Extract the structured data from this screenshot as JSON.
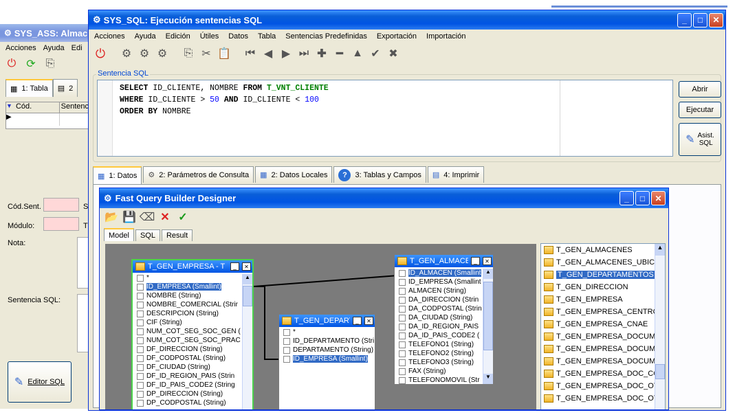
{
  "bg_window": {
    "title": "SYS_ASS: Almac",
    "menus": [
      "Acciones",
      "Ayuda",
      "Edi"
    ],
    "tab_label": "1: Tabla",
    "tab2_label": "2",
    "col_cod": "Cód.",
    "col_sent": "Sentenc",
    "cod_sent_label": "Cód.Sent.",
    "modulo_label": "Módulo:",
    "nota_label": "Nota:",
    "sentencia_label": "Sentencia SQL:",
    "editor_button": "Editor SQL",
    "s_label": "S",
    "t_label": "T"
  },
  "main_window": {
    "title": "SYS_SQL: Ejecución sentencias SQL",
    "menus": [
      "Acciones",
      "Ayuda",
      "Edición",
      "Útiles",
      "Datos",
      "Tabla",
      "Sentencias Predefinidas",
      "Exportación",
      "Importación"
    ],
    "group_label": "Sentencia SQL",
    "sql_lines": [
      [
        "SELECT",
        " ID_CLIENTE, NOMBRE ",
        "FROM",
        " ",
        "T_VNT_CLIENTE"
      ],
      [
        "WHERE",
        " ID_CLIENTE > ",
        "50",
        " ",
        "AND",
        " ID_CLIENTE < ",
        "100"
      ],
      [
        "ORDER BY",
        " NOMBRE"
      ]
    ],
    "btn_abrir": "Abrir",
    "btn_ejecutar": "Ejecutar",
    "btn_asist": "Asist.",
    "btn_asist2": "SQL",
    "tabs": [
      "1: Datos",
      "2: Parámetros de Consulta",
      "2: Datos Locales",
      "3: Tablas y Campos",
      "4: Imprimir"
    ]
  },
  "qb_window": {
    "title": "Fast Query Builder  Designer",
    "tabs": [
      "Model",
      "SQL",
      "Result"
    ],
    "tables": [
      {
        "title": "T_GEN_EMPRESA - T",
        "fields": [
          "*",
          "ID_EMPRESA (Smallint)",
          "NOMBRE (String)",
          "NOMBRE_COMERCIAL (Strir",
          "DESCRIPCION (String)",
          "CIF (String)",
          "NUM_COT_SEG_SOC_GEN (",
          "NUM_COT_SEG_SOC_PRAC",
          "DF_DIRECCION (String)",
          "DF_CODPOSTAL (String)",
          "DF_CIUDAD (String)",
          "DF_ID_REGION_PAIS (Strin",
          "DF_ID_PAIS_CODE2 (String",
          "DP_DIRECCION (String)",
          "DP_CODPOSTAL (String)"
        ],
        "selected": 1
      },
      {
        "title": "T_GEN_DEPART",
        "fields": [
          "*",
          "ID_DEPARTAMENTO (Stri",
          "DEPARTAMENTO (String)",
          "ID_EMPRESA (Smallint)"
        ],
        "selected": 3
      },
      {
        "title": "T_GEN_ALMACE",
        "fields": [
          "ID_ALMACEN (Smallint",
          "ID_EMPRESA (Smallint",
          "ALMACEN (String)",
          "DA_DIRECCION (Strin",
          "DA_CODPOSTAL (Strin",
          "DA_CIUDAD (String)",
          "DA_ID_REGION_PAIS",
          "DA_ID_PAIS_CODE2 (",
          "TELEFONO1 (String)",
          "TELEFONO2 (String)",
          "TELEFONO3 (String)",
          "FAX (String)",
          "TELEFONOMOVIL (Str"
        ],
        "selected": 0
      }
    ],
    "table_list": [
      "T_GEN_ALMACENES",
      "T_GEN_ALMACENES_UBICA(",
      "T_GEN_DEPARTAMENTOS",
      "T_GEN_DIRECCION",
      "T_GEN_EMPRESA",
      "T_GEN_EMPRESA_CENTROS",
      "T_GEN_EMPRESA_CNAE",
      "T_GEN_EMPRESA_DOCUMEI",
      "T_GEN_EMPRESA_DOCUMEI",
      "T_GEN_EMPRESA_DOCUMEI",
      "T_GEN_EMPRESA_DOC_COI",
      "T_GEN_EMPRESA_DOC_OTI",
      "T_GEN_EMPRESA_DOC_OT_"
    ],
    "table_list_selected": 2
  }
}
